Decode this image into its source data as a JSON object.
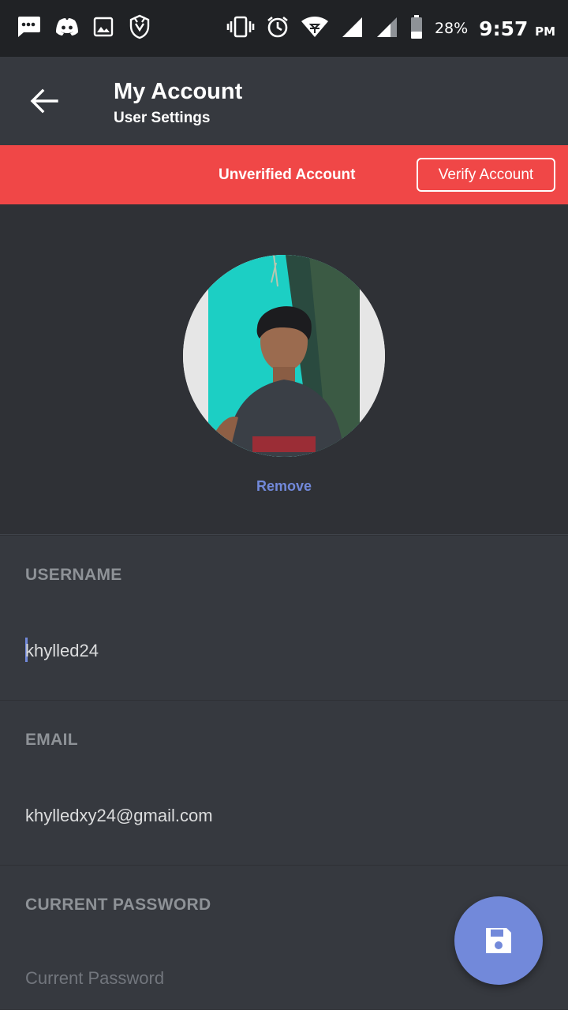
{
  "status_bar": {
    "battery": "28%",
    "time": "9:57",
    "ampm": "PM",
    "icons": [
      "message-icon",
      "discord-icon",
      "gallery-icon",
      "shield-icon",
      "vibrate-icon",
      "alarm-icon",
      "wifi-icon",
      "signal-icon",
      "signal-icon",
      "battery-icon"
    ]
  },
  "appbar": {
    "title": "My Account",
    "subtitle": "User Settings"
  },
  "banner": {
    "text": "Unverified Account",
    "button": "Verify Account",
    "color": "#f04747"
  },
  "avatar": {
    "remove_label": "Remove"
  },
  "form": {
    "username": {
      "label": "USERNAME",
      "value": "khylled24"
    },
    "email": {
      "label": "EMAIL",
      "value": "khylledxy24@gmail.com"
    },
    "password": {
      "label": "CURRENT PASSWORD",
      "placeholder": "Current Password"
    }
  },
  "colors": {
    "accent": "#7289da",
    "background": "#2f3136",
    "surface": "#36393f",
    "statusbar": "#202225"
  },
  "fab": {
    "icon": "save-icon"
  }
}
